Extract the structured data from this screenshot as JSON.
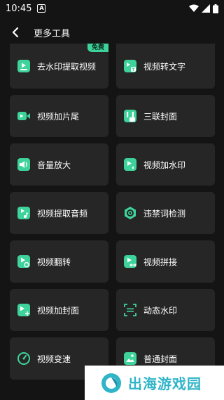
{
  "status_bar": {
    "time": "10:45"
  },
  "header": {
    "title": "更多工具"
  },
  "colors": {
    "accent": "#3ed39b",
    "card": "#262626",
    "background": "#141414"
  },
  "tools": [
    {
      "label": "去水印提取视频",
      "icon": "video-extract-icon",
      "badge": "免费"
    },
    {
      "label": "视频转文字",
      "icon": "video-to-text-icon"
    },
    {
      "label": "视频加片尾",
      "icon": "video-ending-icon"
    },
    {
      "label": "三联封面",
      "icon": "triple-cover-icon"
    },
    {
      "label": "音量放大",
      "icon": "volume-boost-icon"
    },
    {
      "label": "视频加水印",
      "icon": "video-watermark-icon"
    },
    {
      "label": "视频提取音频",
      "icon": "extract-audio-icon"
    },
    {
      "label": "违禁词检测",
      "icon": "banned-word-check-icon"
    },
    {
      "label": "视频翻转",
      "icon": "video-flip-icon"
    },
    {
      "label": "视频拼接",
      "icon": "video-splice-icon"
    },
    {
      "label": "视频加封面",
      "icon": "video-cover-icon"
    },
    {
      "label": "动态水印",
      "icon": "dynamic-watermark-icon"
    },
    {
      "label": "视频变速",
      "icon": "video-speed-icon"
    },
    {
      "label": "普通封面",
      "icon": "normal-cover-icon"
    }
  ],
  "watermark": {
    "text": "出海游戏园"
  }
}
